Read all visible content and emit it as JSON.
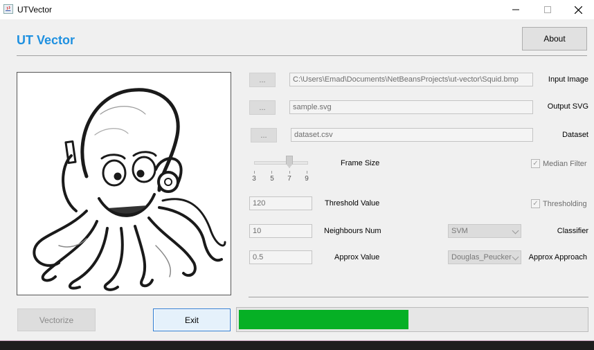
{
  "window": {
    "title": "UTVector"
  },
  "header": {
    "app_title": "UT Vector",
    "about_label": "About"
  },
  "io": {
    "browse_label": "...",
    "input_image": {
      "label": "Input Image",
      "value": "C:\\Users\\Emad\\Documents\\NetBeansProjects\\ut-vector\\Squid.bmp"
    },
    "output_svg": {
      "label": "Output SVG",
      "value": "sample.svg"
    },
    "dataset": {
      "label": "Dataset",
      "value": "dataset.csv"
    }
  },
  "frame_size": {
    "label": "Frame Size",
    "ticks": [
      "3",
      "5",
      "7",
      "9"
    ],
    "selected": "7"
  },
  "median_filter": {
    "label": "Median Filter",
    "checked": true
  },
  "threshold": {
    "label": "Threshold Value",
    "value": "120"
  },
  "thresholding": {
    "label": "Thresholding",
    "checked": true
  },
  "neighbours": {
    "label": "Neighbours Num",
    "value": "10"
  },
  "classifier": {
    "label": "Classifier",
    "value": "SVM"
  },
  "approx": {
    "label": "Approx Value",
    "value": "0.5"
  },
  "approx_approach": {
    "label": "Approx Approach",
    "value": "Douglas_Peucker"
  },
  "actions": {
    "vectorize_label": "Vectorize",
    "exit_label": "Exit"
  },
  "progress": {
    "value": 0.49
  },
  "colors": {
    "accent": "#1e90e0",
    "progress": "#06b025"
  },
  "icons": {
    "app": "java-app-icon",
    "minimize": "minimize-icon",
    "maximize": "maximize-icon",
    "close": "close-icon"
  }
}
